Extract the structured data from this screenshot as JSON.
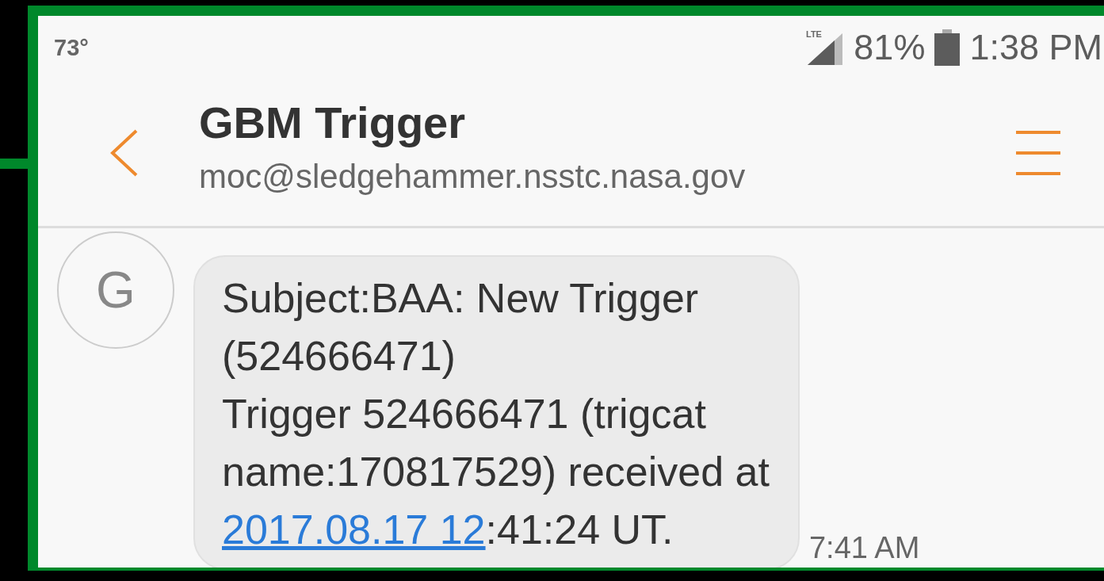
{
  "status_bar": {
    "temperature": "73°",
    "network": "LTE",
    "battery": "81%",
    "time": "1:38 PM"
  },
  "header": {
    "title": "GBM Trigger",
    "subtitle": "moc@sledgehammer.nsstc.nasa.gov"
  },
  "messages": [
    {
      "avatar": "G",
      "lines": [
        "Subject:BAA: New Trigger",
        "(524666471)",
        "Trigger 524666471 (trigcat",
        "name:170817529) received at"
      ],
      "link": "2017.08.17 12",
      "after_link": ":41:24 UT.",
      "time": "7:41 AM"
    }
  ]
}
